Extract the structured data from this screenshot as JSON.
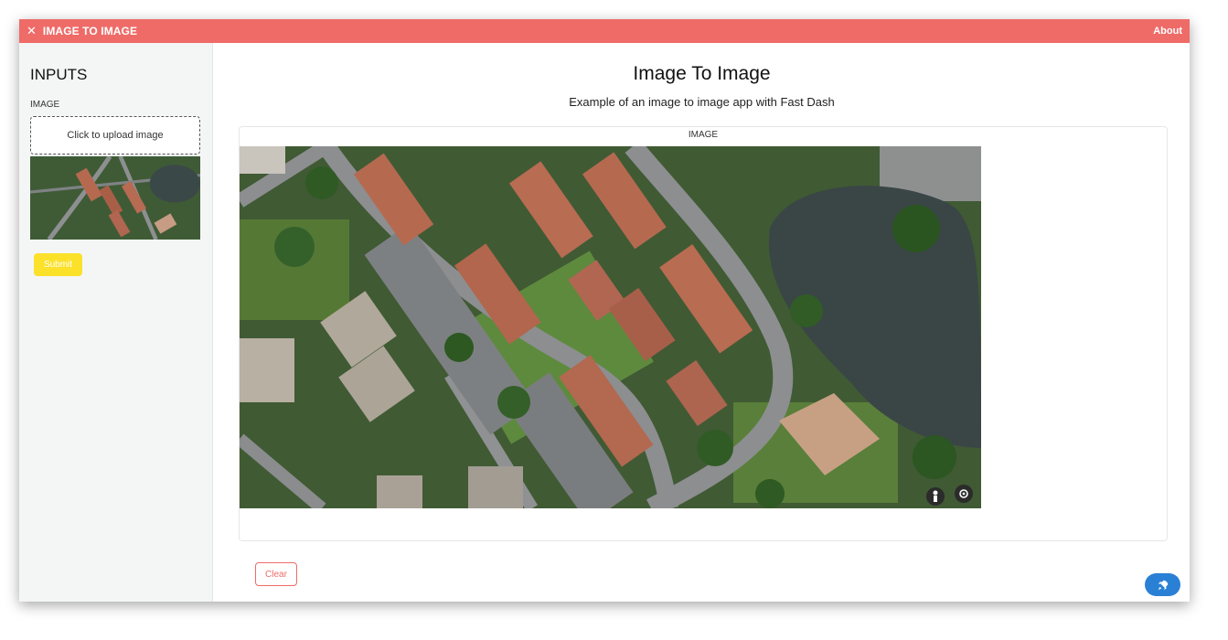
{
  "header": {
    "title": "IMAGE TO IMAGE",
    "close_icon": "close-icon",
    "about_label": "About"
  },
  "sidebar": {
    "heading": "INPUTS",
    "image_label": "IMAGE",
    "upload_text": "Click to upload image",
    "submit_label": "Submit"
  },
  "main": {
    "title": "Image To Image",
    "subtitle": "Example of an image to image app with Fast Dash",
    "output_label": "IMAGE",
    "clear_label": "Clear",
    "fab_icon": "rocket-icon"
  },
  "colors": {
    "accent": "#ee6b68",
    "submit": "#fbe12a",
    "fab": "#2a80d5"
  }
}
